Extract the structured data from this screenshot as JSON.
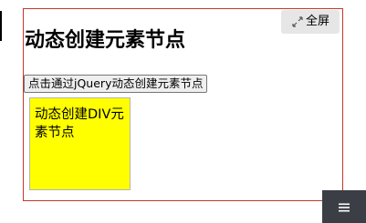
{
  "toolbar": {
    "fullscreen_label": "全屏",
    "fullscreen_icon": "expand-arrows-icon"
  },
  "page": {
    "title": "动态创建元素节点",
    "button_label": "点击通过jQuery动态创建元素节点",
    "box_text": "动态创建DIV元素节点"
  },
  "menu": {
    "icon": "hamburger-menu-icon"
  },
  "colors": {
    "frame_border": "#c0392b",
    "box_background": "#ffff00",
    "menu_background": "#3b3f45"
  }
}
